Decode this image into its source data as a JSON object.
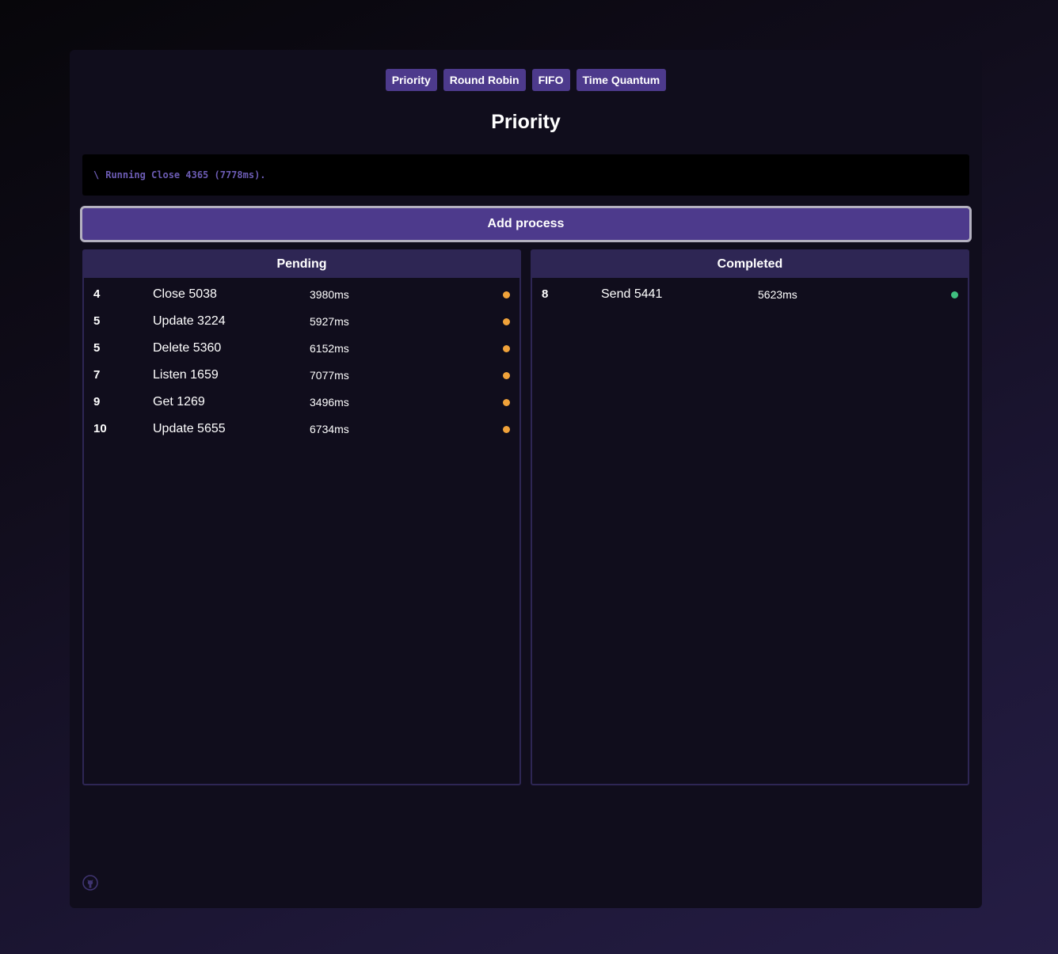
{
  "tabs": [
    "Priority",
    "Round Robin",
    "FIFO",
    "Time Quantum"
  ],
  "title": "Priority",
  "console": {
    "spinner": "\\",
    "message": "Running Close 4365 (7778ms)."
  },
  "add_button_label": "Add process",
  "pending": {
    "header": "Pending",
    "status_color": "#f0a23a",
    "rows": [
      {
        "priority": "4",
        "name": "Close 5038",
        "time": "3980ms"
      },
      {
        "priority": "5",
        "name": "Update 3224",
        "time": "5927ms"
      },
      {
        "priority": "5",
        "name": "Delete 5360",
        "time": "6152ms"
      },
      {
        "priority": "7",
        "name": "Listen 1659",
        "time": "7077ms"
      },
      {
        "priority": "9",
        "name": "Get 1269",
        "time": "3496ms"
      },
      {
        "priority": "10",
        "name": "Update 5655",
        "time": "6734ms"
      }
    ]
  },
  "completed": {
    "header": "Completed",
    "status_color": "#3fbf7f",
    "rows": [
      {
        "priority": "8",
        "name": "Send 5441",
        "time": "5623ms"
      }
    ]
  },
  "colors": {
    "accent": "#4d3a8c",
    "panel_header": "#2e2654",
    "console_text": "#6c5cb4"
  },
  "footer_icon": "github-icon"
}
